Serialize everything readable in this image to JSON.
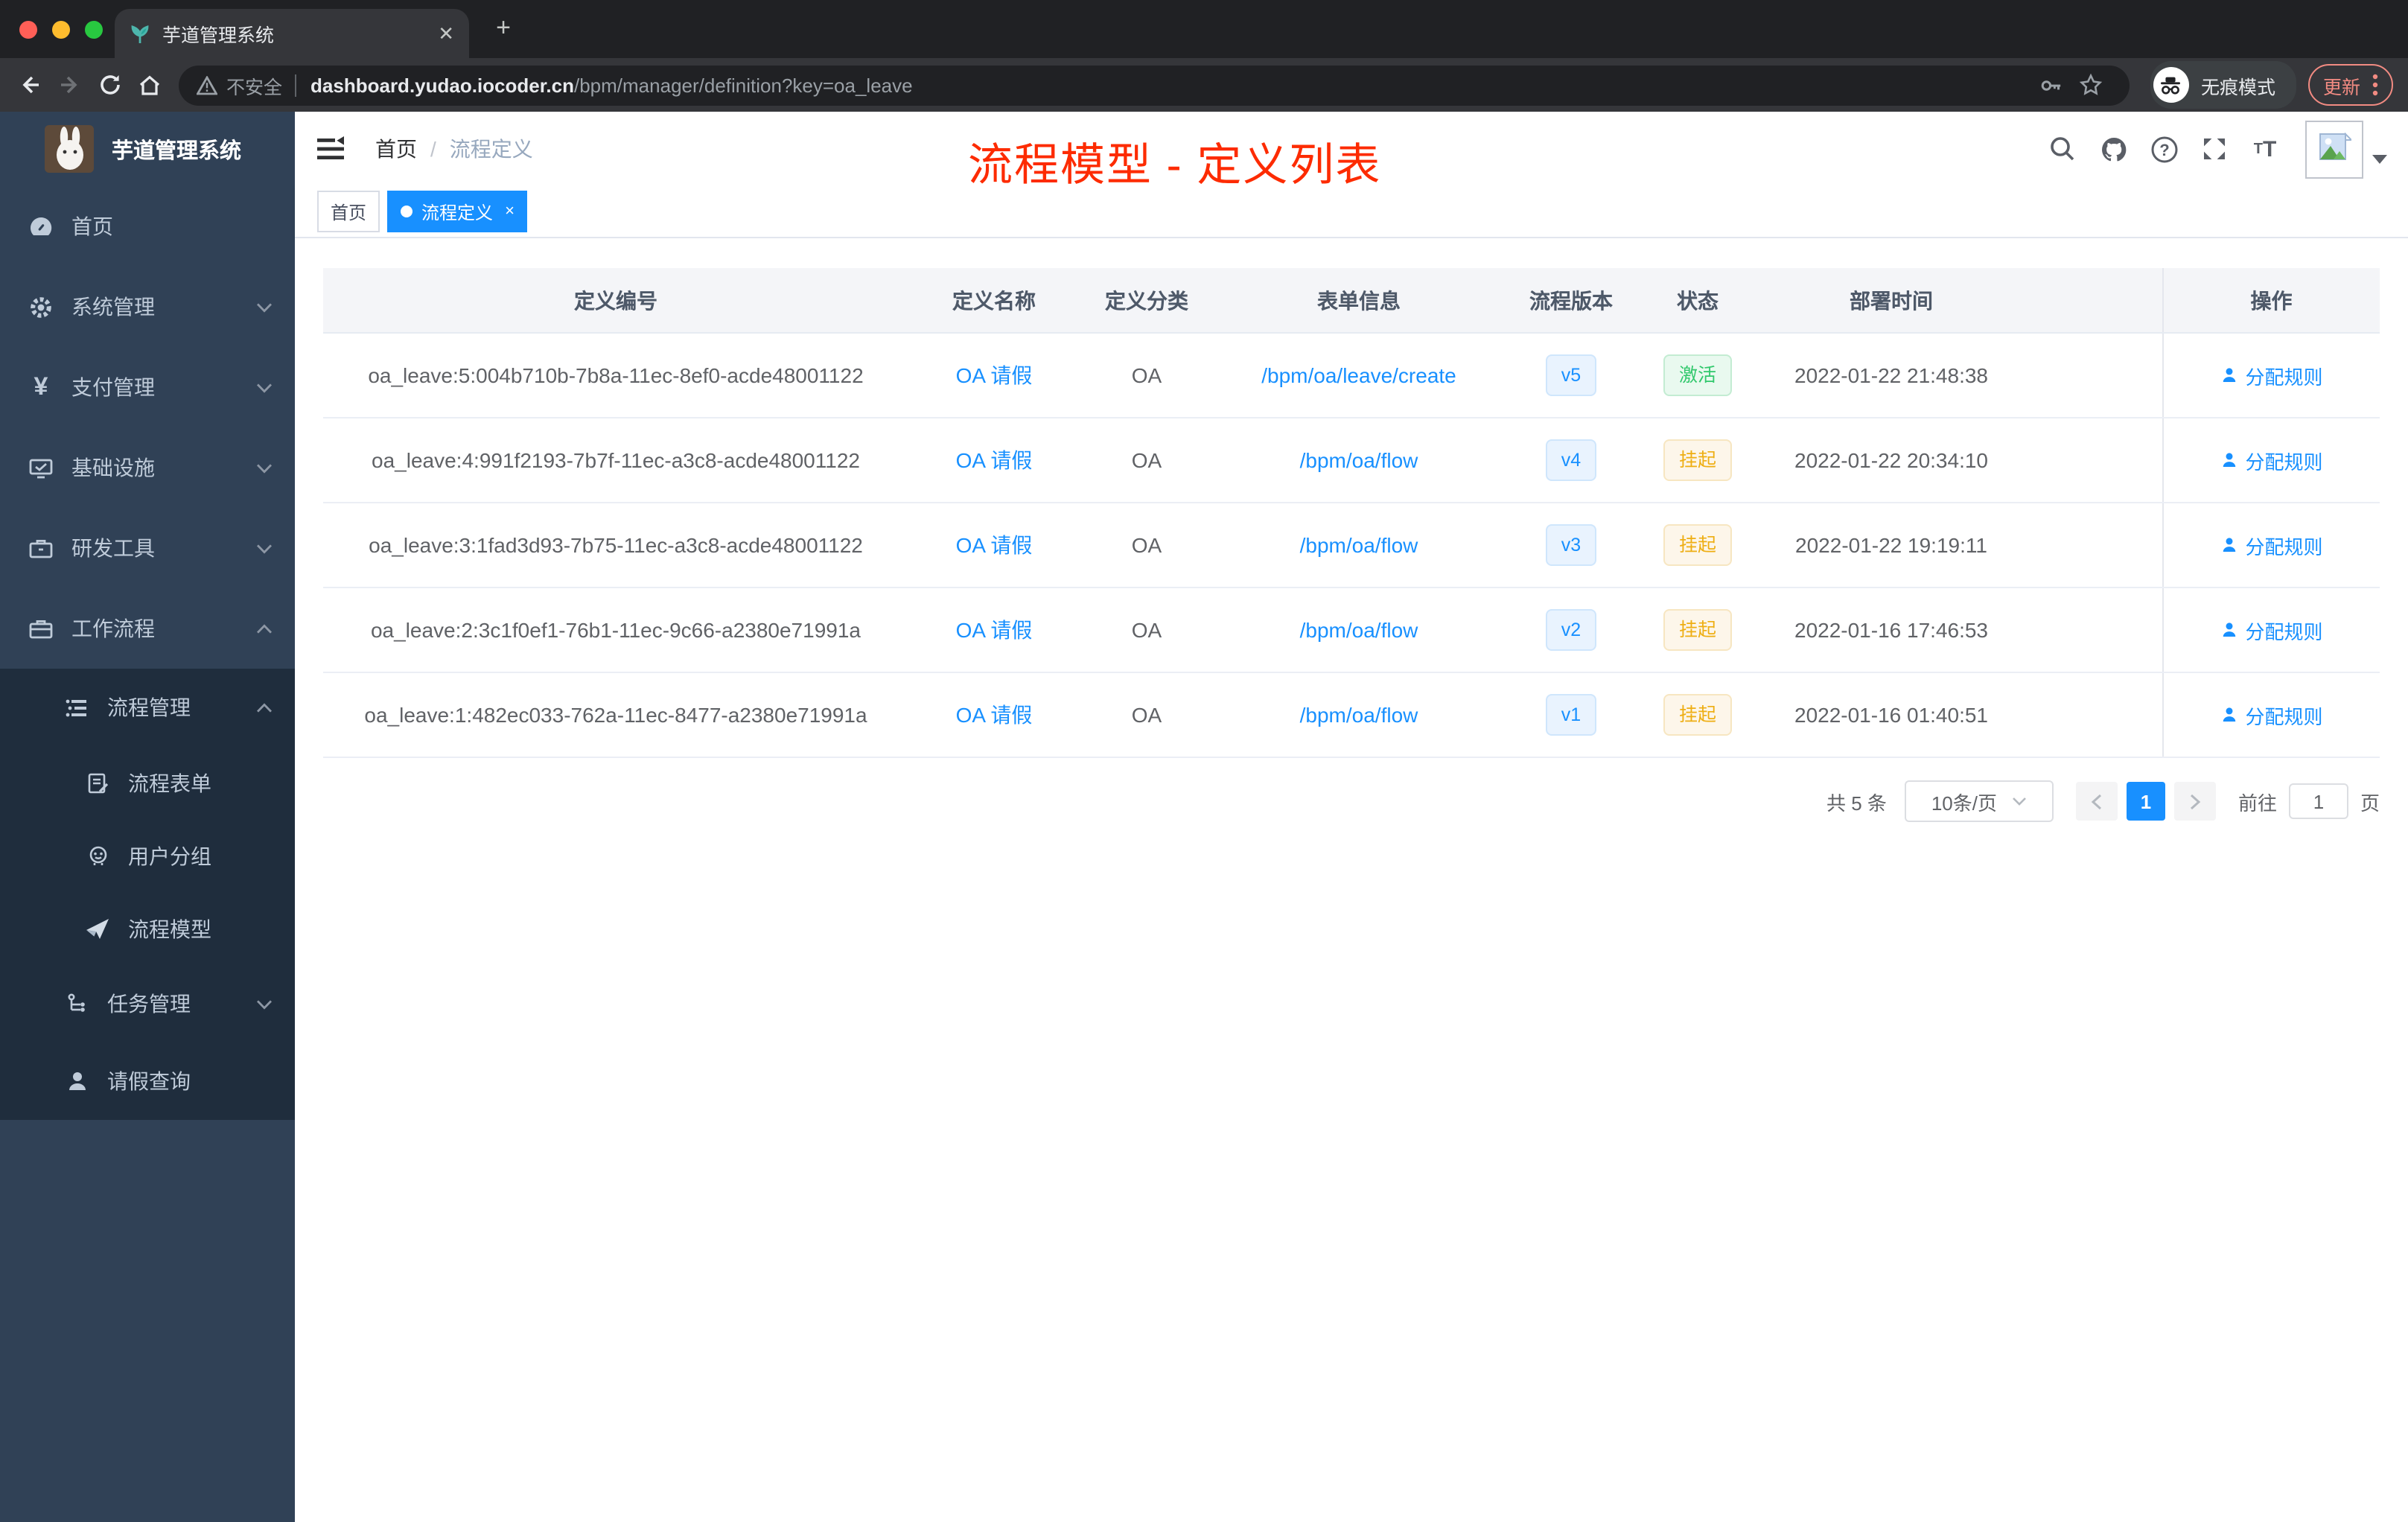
{
  "browser": {
    "tab_title": "芋道管理系统",
    "new_tab_glyph": "+",
    "tab_close_glyph": "✕",
    "security_label": "不安全",
    "url_domain": "dashboard.yudao.iocoder.cn",
    "url_path": "/bpm/manager/definition?key=oa_leave",
    "incognito_label": "无痕模式",
    "update_label": "更新"
  },
  "sidebar": {
    "app_title": "芋道管理系统",
    "items": [
      {
        "label": "首页",
        "icon": "dashboard-icon",
        "level": 1
      },
      {
        "label": "系统管理",
        "icon": "gear-icon",
        "level": 1,
        "chevron": "down"
      },
      {
        "label": "支付管理",
        "icon": "yen-icon",
        "level": 1,
        "chevron": "down"
      },
      {
        "label": "基础设施",
        "icon": "monitor-icon",
        "level": 1,
        "chevron": "down"
      },
      {
        "label": "研发工具",
        "icon": "toolbox-icon",
        "level": 1,
        "chevron": "down"
      },
      {
        "label": "工作流程",
        "icon": "briefcase-icon",
        "level": 1,
        "chevron": "up"
      },
      {
        "label": "流程管理",
        "icon": "list-tree-icon",
        "level": 2,
        "chevron": "up"
      },
      {
        "label": "流程表单",
        "icon": "form-icon",
        "level": 3
      },
      {
        "label": "用户分组",
        "icon": "robot-icon",
        "level": 3
      },
      {
        "label": "流程模型",
        "icon": "paper-plane-icon",
        "level": 3
      },
      {
        "label": "任务管理",
        "icon": "org-tree-icon",
        "level": 2,
        "chevron": "down"
      },
      {
        "label": "请假查询",
        "icon": "user-icon",
        "level": 2
      }
    ]
  },
  "header": {
    "breadcrumb_home": "首页",
    "breadcrumb_sep": "/",
    "breadcrumb_current": "流程定义",
    "annotation": "流程模型 - 定义列表",
    "annotation_color": "#fd2b00"
  },
  "tags": {
    "home": "首页",
    "active": "流程定义",
    "active_close_glyph": "×"
  },
  "table": {
    "columns": [
      "定义编号",
      "定义名称",
      "定义分类",
      "表单信息",
      "流程版本",
      "状态",
      "部署时间",
      "操作"
    ],
    "rows": [
      {
        "id": "oa_leave:5:004b710b-7b8a-11ec-8ef0-acde48001122",
        "name": "OA 请假",
        "category": "OA",
        "form": "/bpm/oa/leave/create",
        "version": "v5",
        "status": "激活",
        "status_type": "success",
        "time": "2022-01-22 21:48:38",
        "action": "分配规则"
      },
      {
        "id": "oa_leave:4:991f2193-7b7f-11ec-a3c8-acde48001122",
        "name": "OA 请假",
        "category": "OA",
        "form": "/bpm/oa/flow",
        "version": "v4",
        "status": "挂起",
        "status_type": "warning",
        "time": "2022-01-22 20:34:10",
        "action": "分配规则"
      },
      {
        "id": "oa_leave:3:1fad3d93-7b75-11ec-a3c8-acde48001122",
        "name": "OA 请假",
        "category": "OA",
        "form": "/bpm/oa/flow",
        "version": "v3",
        "status": "挂起",
        "status_type": "warning",
        "time": "2022-01-22 19:19:11",
        "action": "分配规则"
      },
      {
        "id": "oa_leave:2:3c1f0ef1-76b1-11ec-9c66-a2380e71991a",
        "name": "OA 请假",
        "category": "OA",
        "form": "/bpm/oa/flow",
        "version": "v2",
        "status": "挂起",
        "status_type": "warning",
        "time": "2022-01-16 17:46:53",
        "action": "分配规则"
      },
      {
        "id": "oa_leave:1:482ec033-762a-11ec-8477-a2380e71991a",
        "name": "OA 请假",
        "category": "OA",
        "form": "/bpm/oa/flow",
        "version": "v1",
        "status": "挂起",
        "status_type": "warning",
        "time": "2022-01-16 01:40:51",
        "action": "分配规则"
      }
    ]
  },
  "pagination": {
    "total_label": "共 5 条",
    "page_size_label": "10条/页",
    "current_page": "1",
    "goto_label": "前往",
    "goto_value": "1",
    "page_unit": "页"
  },
  "colors": {
    "accent_blue": "#1890ff",
    "annotation_red": "#fd2b00",
    "status_active_green": "#31c86c",
    "status_suspended_orange": "#eeae13",
    "sidebar_bg": "#304156",
    "submenu_bg": "#1f2d3d"
  }
}
